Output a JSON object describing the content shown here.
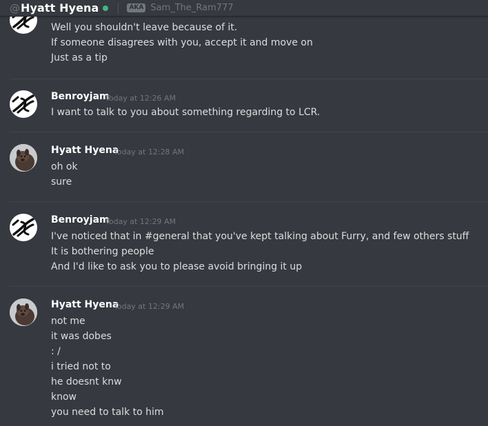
{
  "header": {
    "at_symbol": "@",
    "title": "Hyatt Hyena",
    "aka_badge": "AKA",
    "aka_name": "Sam_The_Ram777",
    "status_color": "#43b581"
  },
  "messages": [
    {
      "author": "",
      "timestamp": "",
      "avatar": "benroyjam-logo",
      "lines": [
        "Well you shouldn't leave because of it.",
        "If someone disagrees with you, accept it and move on",
        "Just as a tip"
      ]
    },
    {
      "author": "Benroyjam",
      "timestamp": "Today at 12:26 AM",
      "avatar": "benroyjam-logo",
      "lines": [
        "I want to talk to you about something regarding to LCR."
      ]
    },
    {
      "author": "Hyatt Hyena",
      "timestamp": "Today at 12:28 AM",
      "avatar": "hyena-photo",
      "lines": [
        "oh ok",
        "sure"
      ]
    },
    {
      "author": "Benroyjam",
      "timestamp": "Today at 12:29 AM",
      "avatar": "benroyjam-logo",
      "lines": [
        "I've noticed that in #general that you've kept talking about Furry, and few others stuff",
        "It is bothering people",
        "And I'd like to ask you to please avoid bringing it up"
      ]
    },
    {
      "author": "Hyatt Hyena",
      "timestamp": "Today at 12:29 AM",
      "avatar": "hyena-photo",
      "lines": [
        "not me",
        "it was dobes",
        ": /",
        "i tried not to",
        "he doesnt knw",
        "know",
        "you need to talk to him"
      ]
    }
  ]
}
